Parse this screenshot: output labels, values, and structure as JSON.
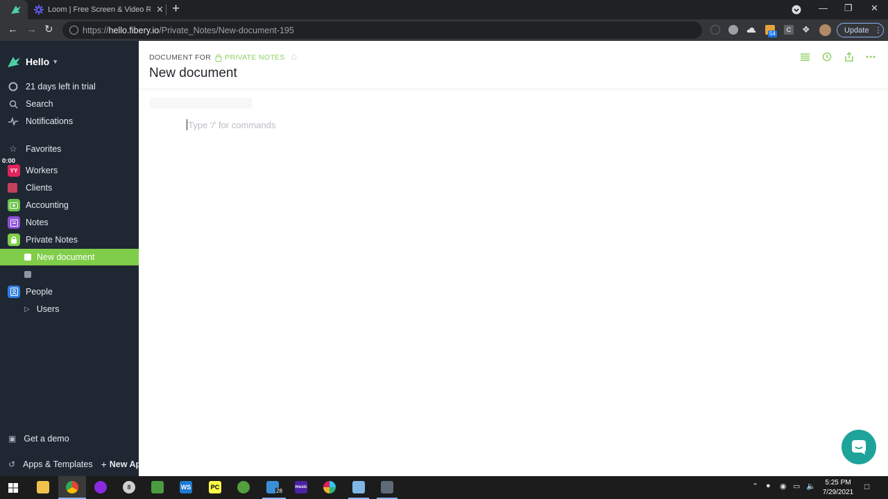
{
  "browser": {
    "tab_title": "Loom | Free Screen & Video Recording Software",
    "tab_close": "✕",
    "new_tab": "+",
    "url_prefix": "https://",
    "url_host": "hello.fibery.io",
    "url_path": "/Private_Notes/New-document-195",
    "ext_badge_count": "54",
    "ext_c_label": "C",
    "update_label": "Update",
    "window_controls": [
      "—",
      "❐",
      "✕"
    ]
  },
  "sidebar": {
    "workspace_name": "Hello",
    "timer": "0:00",
    "top_items": [
      {
        "label": "21 days left in trial",
        "icon": "trial-progress-icon"
      },
      {
        "label": "Search",
        "icon": "search-icon"
      },
      {
        "label": "Notifications",
        "icon": "pulse-icon"
      }
    ],
    "favorites_label": "Favorites",
    "apps": [
      {
        "label": "Workers",
        "icon_text": "YY",
        "color": "#e2245c"
      },
      {
        "label": "Clients",
        "icon_text": "",
        "color": "#c2405a"
      },
      {
        "label": "Accounting",
        "icon_text": "",
        "color": "#6ac24a"
      },
      {
        "label": "Notes",
        "icon_text": "",
        "color": "#8c4fd6"
      },
      {
        "label": "Private Notes",
        "icon_text": "",
        "color": "#80cd4a"
      }
    ],
    "active_doc": "New document",
    "empty_doc": "",
    "people_label": "People",
    "users_label": "Users",
    "get_demo": "Get a demo",
    "apps_templates": "Apps & Templates",
    "new_app": "New Ap"
  },
  "main": {
    "crumb_for": "DOCUMENT FOR",
    "crumb_app": "PRIVATE NOTES",
    "title": "New document",
    "editor_placeholder": "Type '/' for commands"
  },
  "taskbar": {
    "time": "5:25 PM",
    "date": "7/29/2021",
    "folder_badge": "28",
    "music_label": "music"
  },
  "colors": {
    "accent_green": "#80cd4a",
    "sidebar_bg": "#1f2733",
    "intercom_teal": "#1ea39a"
  }
}
